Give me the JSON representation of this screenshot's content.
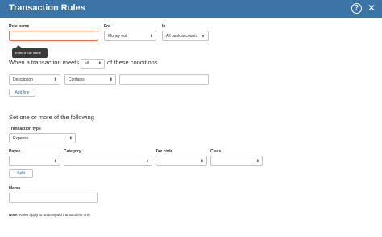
{
  "window": {
    "title": "Transaction Rules",
    "help_glyph": "?",
    "close_glyph": "✕"
  },
  "rule_name": {
    "label": "Rule name",
    "value": "",
    "tooltip": "Enter a rule name"
  },
  "for": {
    "label": "For",
    "selected": "Money out"
  },
  "in": {
    "label": "In",
    "selected": "All bank accounts"
  },
  "conditions": {
    "prefix": "When a transaction meets",
    "match_selected": "all",
    "suffix": "of these conditions",
    "field_selected": "Description",
    "operator_selected": "Contains",
    "value": "",
    "add_line_label": "Add line"
  },
  "actions": {
    "heading": "Set one or more of the following",
    "transaction_type_label": "Transaction type",
    "transaction_type_selected": "Expense",
    "payee_label": "Payee",
    "category_label": "Category",
    "tax_code_label": "Tax code",
    "class_label": "Class",
    "payee_value": "",
    "category_value": "",
    "tax_code_value": "",
    "class_value": "",
    "split_label": "Split",
    "memo_label": "Memo",
    "memo_value": ""
  },
  "note": {
    "bold": "Note:",
    "text": "Rules apply to unaccepted transactions only."
  },
  "colors": {
    "titlebar": "#3c74a8",
    "link": "#2c72b8",
    "focus_border": "#e0704a"
  }
}
